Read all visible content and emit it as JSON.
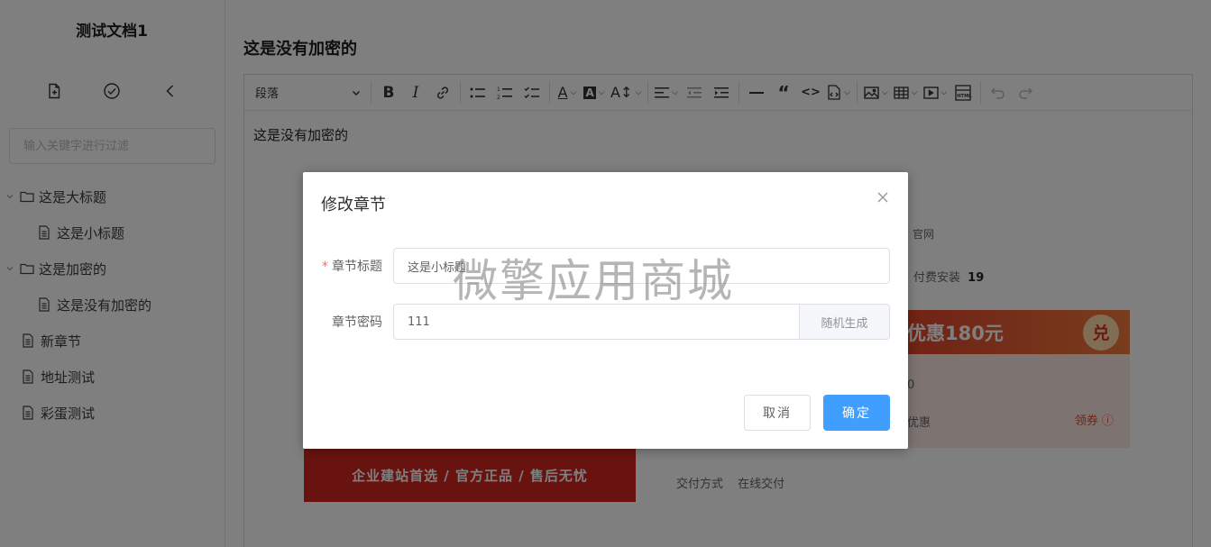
{
  "sidebar": {
    "doc_title": "测试文档1",
    "actions": [
      {
        "name": "new-file-icon"
      },
      {
        "name": "check-circle-icon"
      },
      {
        "name": "collapse-left-icon"
      }
    ],
    "filter_placeholder": "输入关键字进行过滤",
    "tree": [
      {
        "label": "这是大标题",
        "icon": "folder-icon",
        "level": 0,
        "expandable": true
      },
      {
        "label": "这是小标题",
        "icon": "document-icon",
        "level": 1,
        "expandable": false
      },
      {
        "label": "这是加密的",
        "icon": "folder-icon",
        "level": 0,
        "expandable": true
      },
      {
        "label": "这是没有加密的",
        "icon": "document-icon",
        "level": 1,
        "expandable": false
      },
      {
        "label": "新章节",
        "icon": "document-icon",
        "level": 0,
        "expandable": false
      },
      {
        "label": "地址测试",
        "icon": "document-icon",
        "level": 0,
        "expandable": false
      },
      {
        "label": "彩蛋测试",
        "icon": "document-icon",
        "level": 0,
        "expandable": false
      }
    ]
  },
  "main": {
    "page_title": "这是没有加密的",
    "toolbar": {
      "paragraph_select": "段落"
    },
    "content_text": "这是没有加密的",
    "background": {
      "banner_text": "企业建站首选 / 官方正品 / 售后无忧",
      "coupon_title": "优惠180元",
      "coupon_badge": "兑",
      "coupon_link": "领券",
      "coupon_fragment": "优惠",
      "coupon_fragment2": "0",
      "site_fragment": "官网",
      "paid_install_label": "付费安装",
      "paid_install_count": "19",
      "delivery_label": "交付方式",
      "delivery_value": "在线交付"
    }
  },
  "dialog": {
    "title": "修改章节",
    "fields": {
      "title_label": "章节标题",
      "title_value": "这是小标题",
      "password_label": "章节密码",
      "password_value": "111",
      "random_button": "随机生成"
    },
    "cancel_label": "取消",
    "confirm_label": "确定"
  },
  "watermark": "微擎应用商城",
  "colors": {
    "primary": "#409eff",
    "required": "#f56c6c",
    "overlay": "rgba(0,0,0,0.5)"
  }
}
